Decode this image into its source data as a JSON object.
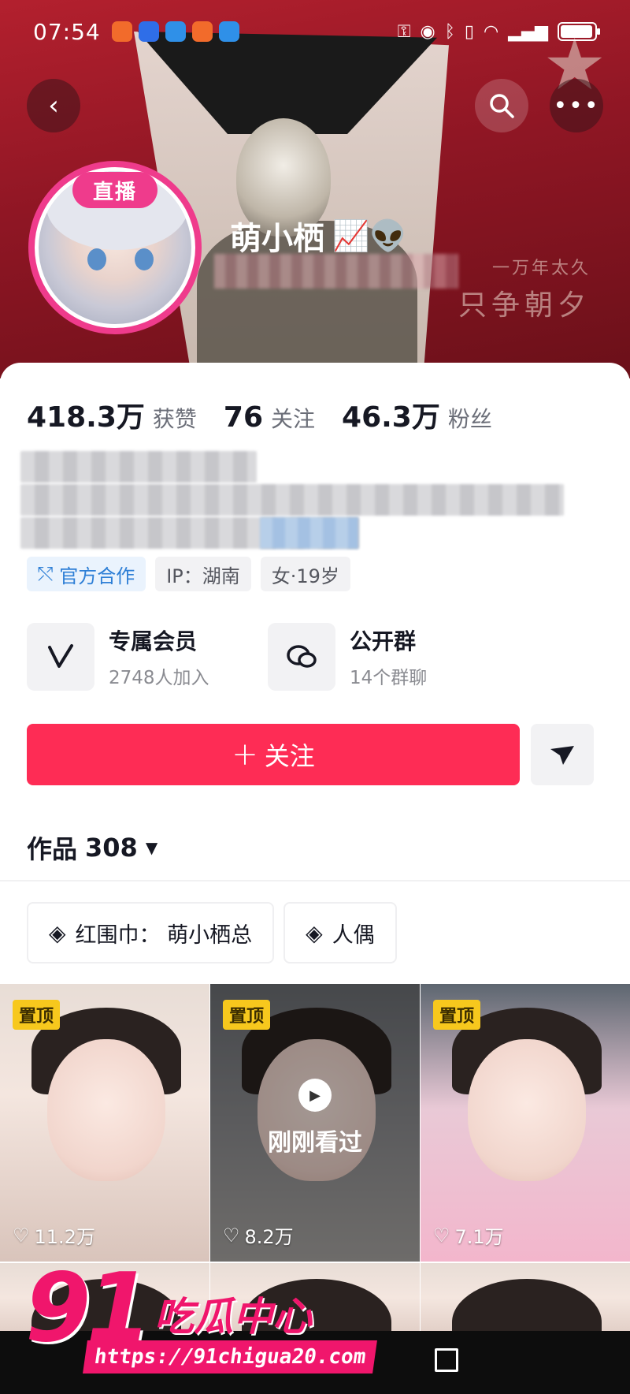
{
  "status_bar": {
    "time": "07:54",
    "app_icon_colors": [
      "#f26b2b",
      "#2f6ee8",
      "#2f90e8",
      "#f26b2b",
      "#2f90e8"
    ],
    "signal": "6"
  },
  "header": {
    "live_badge": "直播",
    "nickname": "萌小栖",
    "nickname_emojis": "📈👽",
    "slogan_line1": "一万年太久",
    "slogan_line2": "只争朝夕"
  },
  "stats": [
    {
      "num": "418.3万",
      "label": "获赞"
    },
    {
      "num": "76",
      "label": "关注"
    },
    {
      "num": "46.3万",
      "label": "粉丝"
    }
  ],
  "tags": {
    "official": "官方合作",
    "ip": "IP：湖南",
    "gender_age": "女·19岁"
  },
  "features": [
    {
      "icon": "v-icon",
      "title": "专属会员",
      "sub": "2748人加入"
    },
    {
      "icon": "chat-icon",
      "title": "公开群",
      "sub": "14个群聊"
    }
  ],
  "actions": {
    "follow_label": "关注",
    "accent_color": "#fe2c55"
  },
  "works": {
    "label": "作品",
    "count": "308"
  },
  "collections": [
    {
      "label": "红围巾： 萌小栖总"
    },
    {
      "label": "人偶"
    }
  ],
  "videos": [
    {
      "pinned": "置顶",
      "likes": "11.2万"
    },
    {
      "pinned": "置顶",
      "likes": "8.2万",
      "recent": "刚刚看过"
    },
    {
      "pinned": "置顶",
      "likes": "7.1万"
    }
  ],
  "watermark": {
    "number": "91",
    "brand": "吃瓜中心",
    "url": "https://91chigua20.com"
  }
}
